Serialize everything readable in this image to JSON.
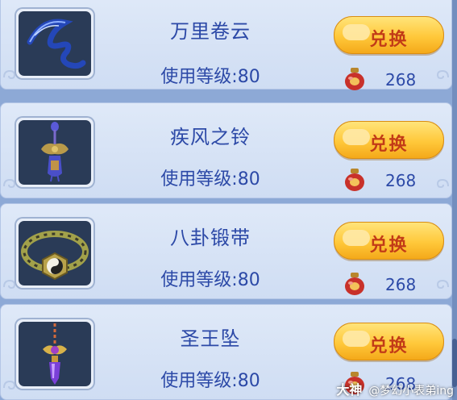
{
  "items": [
    {
      "name": "万里卷云",
      "level": "使用等级:80",
      "button": "兑换",
      "price": "268",
      "icon": "blue-ribbon-icon"
    },
    {
      "name": "疾风之铃",
      "level": "使用等级:80",
      "button": "兑换",
      "price": "268",
      "icon": "wind-bell-icon"
    },
    {
      "name": "八卦锻带",
      "level": "使用等级:80",
      "button": "兑换",
      "price": "268",
      "icon": "bagua-belt-icon"
    },
    {
      "name": "圣王坠",
      "level": "使用等级:80",
      "button": "兑换",
      "price": "268",
      "icon": "saint-king-pendant-icon"
    }
  ],
  "currency_icon": "red-jar-icon",
  "watermark": {
    "brand": "大神",
    "handle": "@梦幻小表弟ing"
  },
  "colors": {
    "text": "#2c49a7",
    "button": "#ffc83a",
    "button_text": "#c23b17",
    "row_bg": "#d8e4f6"
  }
}
